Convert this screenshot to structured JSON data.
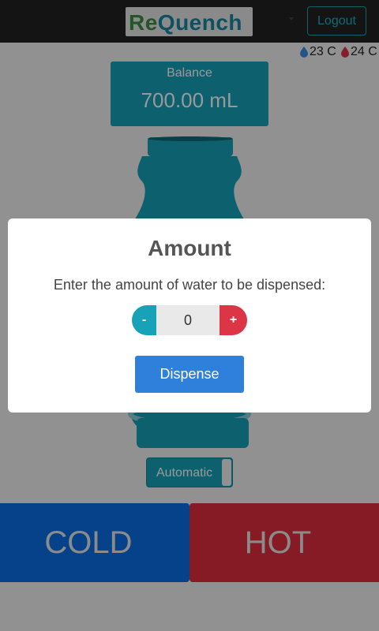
{
  "navbar": {
    "logo_text_part1": "Re",
    "logo_text_part2": "uench",
    "logout_label": "Logout"
  },
  "temperatures": {
    "cold": "23 C",
    "hot": "24 C"
  },
  "balance": {
    "label": "Balance",
    "value": "700.00 mL"
  },
  "mode": {
    "label": "Automatic"
  },
  "dispense_buttons": {
    "cold_label": "COLD",
    "hot_label": "HOT"
  },
  "modal": {
    "title": "Amount",
    "text": "Enter the amount of water to be dispensed:",
    "minus_label": "-",
    "plus_label": "+",
    "amount_value": "0",
    "dispense_label": "Dispense"
  },
  "colors": {
    "primary": "#17a2b8",
    "cold": "#0b6ee6",
    "hot": "#e02c3f",
    "dispense": "#2f80db"
  }
}
